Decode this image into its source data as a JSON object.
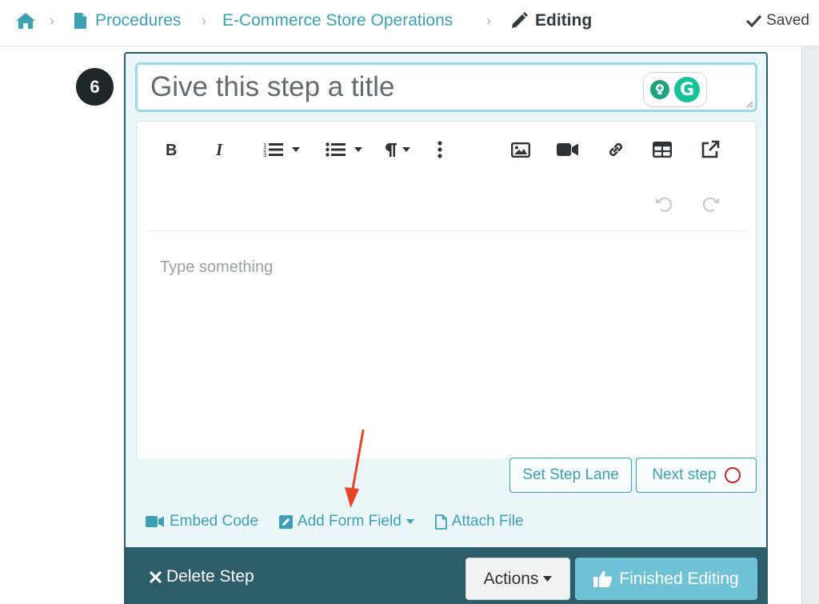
{
  "breadcrumb": {
    "items": [
      "Procedures",
      "E-Commerce Store Operations"
    ],
    "current": "Editing"
  },
  "status": {
    "saved_label": "Saved"
  },
  "step": {
    "number": "6",
    "title_placeholder": "Give this step a title",
    "body_placeholder": "Type something"
  },
  "toolbar": {
    "icons": [
      "bold-icon",
      "italic-icon",
      "ordered-list-icon",
      "unordered-list-icon",
      "paragraph-icon",
      "more-icon",
      "image-icon",
      "video-icon",
      "link-icon",
      "table-icon",
      "external-link-icon",
      "undo-icon",
      "redo-icon"
    ]
  },
  "actions": {
    "set_step_lane": "Set Step Lane",
    "next_step": "Next step",
    "embed_code": "Embed Code",
    "add_form_field": "Add Form Field",
    "attach_file": "Attach File",
    "delete_step": "Delete Step",
    "actions_menu": "Actions",
    "finished_editing": "Finished Editing"
  },
  "colors": {
    "accent": "#3ea0b3",
    "footer": "#2c5d68",
    "finish_button": "#6fc2d6",
    "annotation_arrow": "#e8462a"
  }
}
